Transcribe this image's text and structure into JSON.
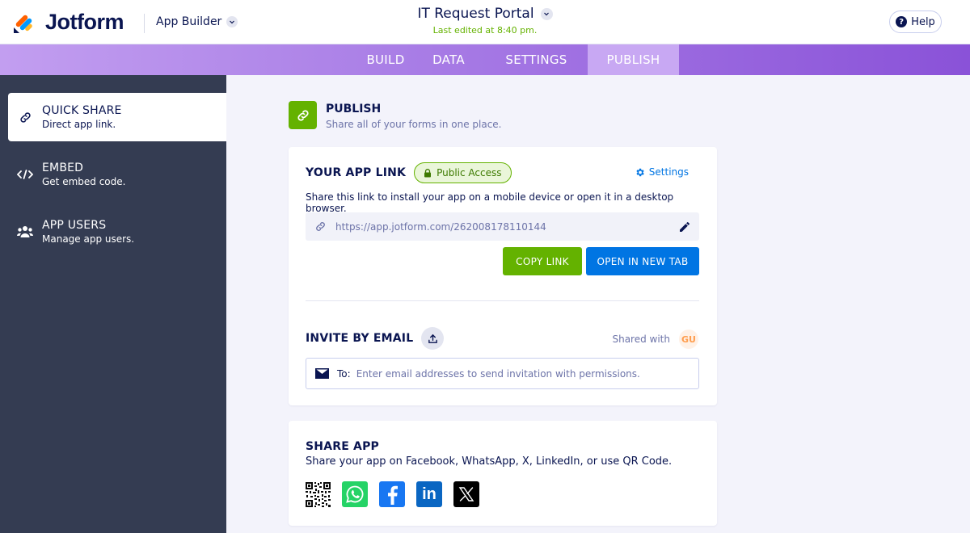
{
  "header": {
    "brand": "Jotform",
    "app_builder_label": "App Builder",
    "app_title": "IT Request Portal",
    "last_edited": "Last edited at 8:40 pm.",
    "help_label": "Help"
  },
  "nav": {
    "tabs": [
      {
        "label": "BUILD"
      },
      {
        "label": "DATA"
      },
      {
        "label": "SETTINGS"
      },
      {
        "label": "PUBLISH",
        "active": true
      }
    ]
  },
  "sidebar": {
    "items": [
      {
        "title": "QUICK SHARE",
        "subtitle": "Direct app link.",
        "icon": "link-icon",
        "active": true
      },
      {
        "title": "EMBED",
        "subtitle": "Get embed code.",
        "icon": "code-icon"
      },
      {
        "title": "APP USERS",
        "subtitle": "Manage app users.",
        "icon": "users-icon"
      }
    ]
  },
  "publish": {
    "title": "PUBLISH",
    "subtitle": "Share all of your forms in one place."
  },
  "app_link": {
    "heading": "YOUR APP LINK",
    "access_badge": "Public Access",
    "settings_label": "Settings",
    "description": "Share this link to install your app on a mobile device or open it in a desktop browser.",
    "url": "https://app.jotform.com/262008178110144",
    "copy_label": "COPY LINK",
    "open_label": "OPEN IN NEW TAB"
  },
  "invite": {
    "heading": "INVITE BY EMAIL",
    "shared_with_label": "Shared with",
    "avatar_initials": "GU",
    "to_label": "To:",
    "email_placeholder": "Enter email addresses to send invitation with permissions."
  },
  "share_app": {
    "heading": "SHARE APP",
    "description": "Share your app on Facebook, WhatsApp, X, LinkedIn, or use QR Code.",
    "buttons": [
      "qr-code-icon",
      "whatsapp-icon",
      "facebook-icon",
      "linkedin-icon",
      "x-icon"
    ],
    "linkedin_glyph": "in"
  },
  "colors": {
    "accent_green": "#64b200",
    "accent_blue": "#0075e3",
    "sidebar_bg": "#343c52",
    "navy": "#0a1551"
  }
}
